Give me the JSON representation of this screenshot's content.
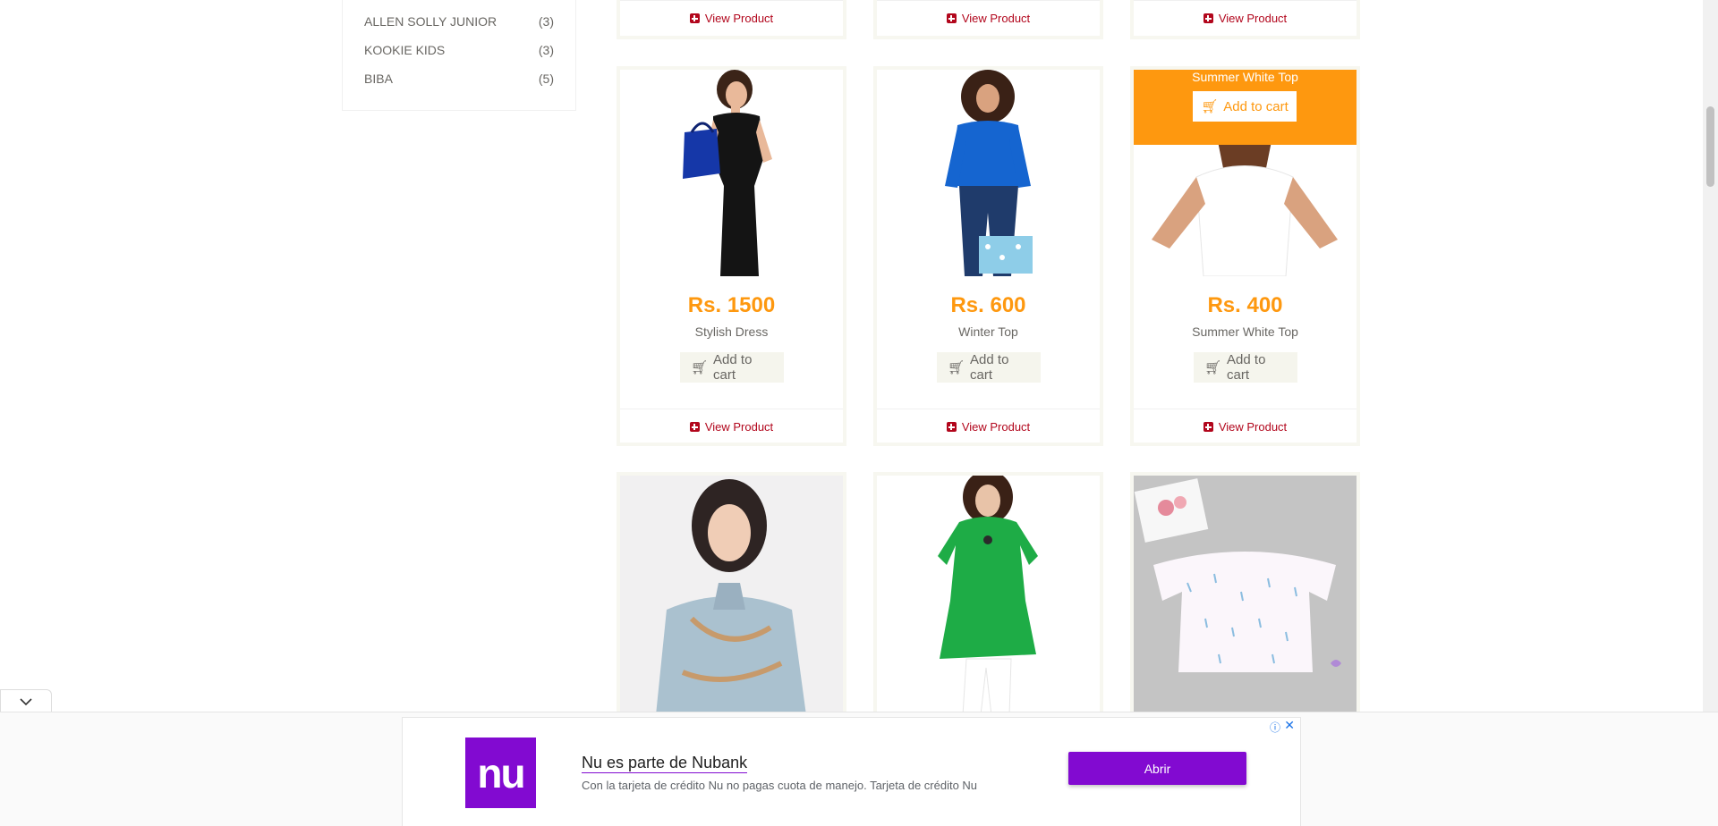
{
  "brands": [
    {
      "name": "ALLEN SOLLY JUNIOR",
      "count": "(3)"
    },
    {
      "name": "KOOKIE KIDS",
      "count": "(3)"
    },
    {
      "name": "BIBA",
      "count": "(5)"
    }
  ],
  "view_product_label": "View Product",
  "add_to_cart_label": "Add to cart",
  "products": [
    {
      "price": "Rs. 1500",
      "name": "Stylish Dress",
      "image": "woman-black-dress-shopping-bag"
    },
    {
      "price": "Rs. 600",
      "name": "Winter Top",
      "image": "woman-blue-top-shopping-bag"
    },
    {
      "price": "Rs. 400",
      "name": "Summer White Top",
      "image": "woman-white-top",
      "overlay_title": "Summer White Top"
    },
    {
      "image": "woman-floral-blouse"
    },
    {
      "image": "woman-green-top"
    },
    {
      "image": "kids-white-off-shoulder-top"
    }
  ],
  "ad": {
    "logo_text": "nu",
    "title": "Nu es parte de Nubank",
    "description": "Con la tarjeta de crédito Nu no pagas cuota de manejo. Tarjeta de crédito Nu",
    "cta": "Abrir",
    "info_icon": "ⓘ",
    "close_icon": "✕"
  },
  "colors": {
    "accent": "#fe980f",
    "link": "#b2061c",
    "nubank": "#820ad1"
  }
}
